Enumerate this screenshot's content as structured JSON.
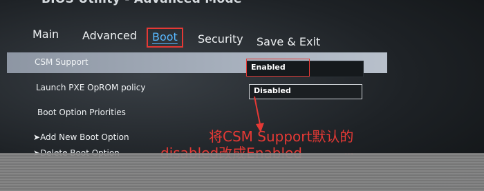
{
  "window": {
    "title": "BIOS Utility - Advanced Mode"
  },
  "tabs": [
    {
      "label": "Main"
    },
    {
      "label": "Advanced"
    },
    {
      "label": "Boot"
    },
    {
      "label": "Security"
    },
    {
      "label": "Save & Exit"
    }
  ],
  "settings": {
    "csm_label": "CSM Support",
    "csm_value": "Enabled",
    "pxe_label": "Launch PXE OpROM policy",
    "pxe_value": "Disabled",
    "boot_priorities": "Boot Option Priorities",
    "add_boot": "Add New Boot Option",
    "delete_boot": "Delete Boot Option"
  },
  "annotation": {
    "line1": "将CSM Support默认的",
    "line2": "disabled改成Enabled",
    "line3": "..."
  },
  "colors": {
    "highlight_red": "#e53935",
    "active_tab": "#58b8ff"
  }
}
